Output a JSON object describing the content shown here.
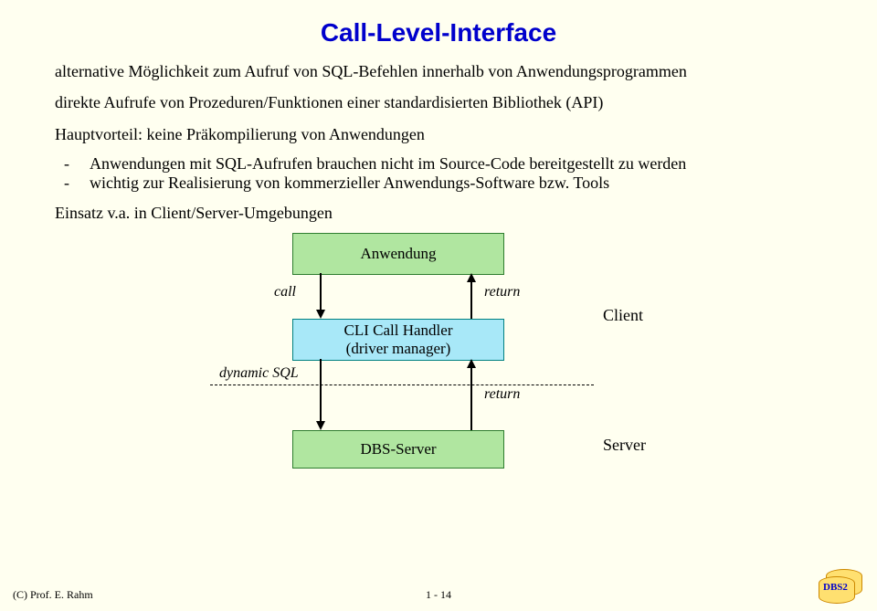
{
  "title": "Call-Level-Interface",
  "para1": "alternative Möglichkeit zum Aufruf von SQL-Befehlen innerhalb von Anwendungsprogrammen",
  "para2": "direkte Aufrufe von Prozeduren/Funktionen einer standardisierten Bibliothek (API)",
  "para3": "Hauptvorteil: keine Präkompilierung von Anwendungen",
  "bullet1": "Anwendungen mit SQL-Aufrufen brauchen nicht im Source-Code bereitgestellt zu werden",
  "bullet2": "wichtig zur Realisierung von kommerzieller Anwendungs-Software bzw. Tools",
  "para4": "Einsatz v.a. in Client/Server-Umgebungen",
  "diagram": {
    "box_app": "Anwendung",
    "box_handler_l1": "CLI Call Handler",
    "box_handler_l2": "(driver manager)",
    "box_server": "DBS-Server",
    "label_call": "call",
    "label_return1": "return",
    "label_dynsql": "dynamic SQL",
    "label_return2": "return",
    "side_client": "Client",
    "side_server": "Server"
  },
  "footer": {
    "left": "(C) Prof. E. Rahm",
    "center": "1 - 14",
    "db": "DBS2"
  }
}
